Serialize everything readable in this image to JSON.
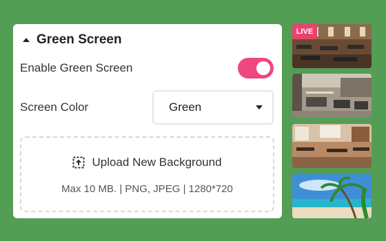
{
  "panel": {
    "title": "Green Screen",
    "enable": {
      "label": "Enable Green Screen",
      "on": true
    },
    "screen_color": {
      "label": "Screen Color",
      "selected": "Green"
    },
    "upload": {
      "button_label": "Upload New Background",
      "hint": "Max 10 MB. | PNG, JPEG | 1280*720"
    }
  },
  "thumbnails": [
    {
      "badge": "LIVE",
      "scene": "restaurant interior"
    },
    {
      "scene": "restaurant interior"
    },
    {
      "scene": "restaurant interior"
    },
    {
      "scene": "tropical beach"
    }
  ],
  "colors": {
    "background": "#549d55",
    "toggle_on": "#ef4780",
    "live_badge": "#e8436f"
  }
}
